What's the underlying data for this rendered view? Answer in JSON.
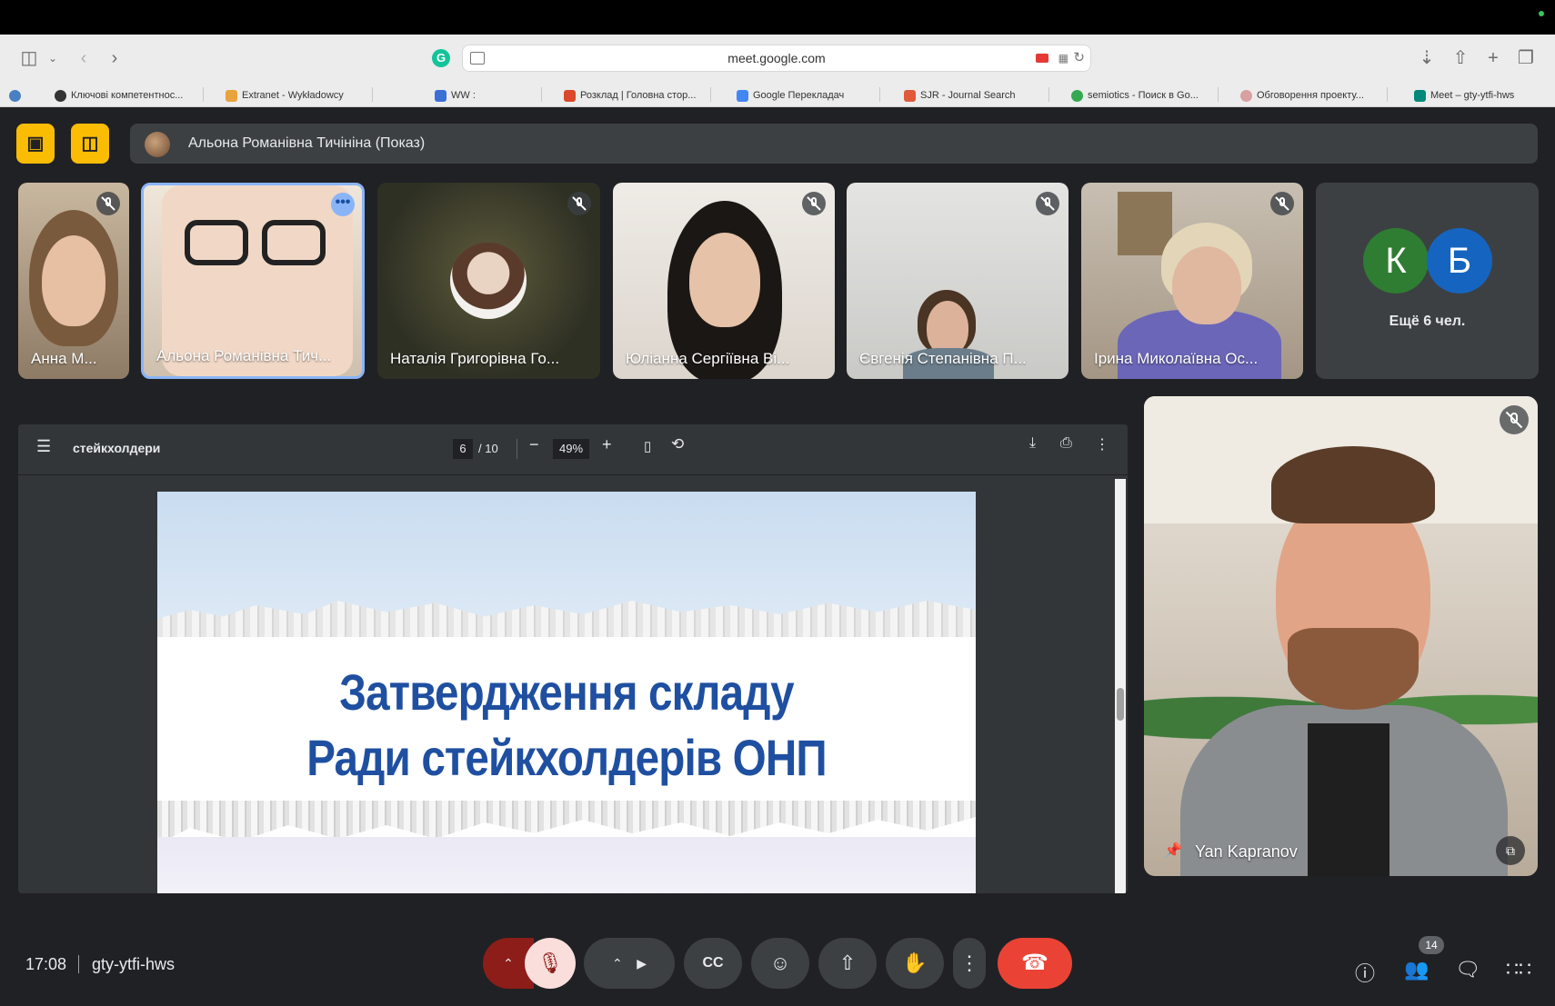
{
  "browser": {
    "url": "meet.google.com",
    "bookmarks": [
      {
        "label": "Ключові компетентнос...",
        "color": "#333333"
      },
      {
        "label": "Extranet - Wykładowcy",
        "color": "#e8a33d"
      },
      {
        "label": "WW :",
        "color": "#3b6fd6"
      },
      {
        "label": "Розклад | Головна стор...",
        "color": "#d9482b"
      },
      {
        "label": "Google Перекладач",
        "color": "#4285f4"
      },
      {
        "label": "SJR - Journal Search",
        "color": "#e0593a"
      },
      {
        "label": "semiotics - Поиск в Go...",
        "color": "#34a853"
      },
      {
        "label": "Обговорення проекту...",
        "color": "#d8a0a0"
      },
      {
        "label": "Meet – gty-ytfi-hws",
        "color": "#00897b"
      }
    ]
  },
  "presenter": {
    "label": "Альона Романівна Тичініна (Показ)"
  },
  "participants": [
    {
      "name": "Анна М..."
    },
    {
      "name": "Альона Романівна Тич..."
    },
    {
      "name": "Наталія Григорівна Го..."
    },
    {
      "name": "Юліанна Сергіївна Ві..."
    },
    {
      "name": "Євгенія Степанівна П..."
    },
    {
      "name": "Ірина Миколаївна Ос..."
    }
  ],
  "more_tile": {
    "avatars": [
      {
        "letter": "К",
        "color": "#2e7d32"
      },
      {
        "letter": "Б",
        "color": "#1565c0"
      }
    ],
    "label": "Ещё 6 чел."
  },
  "pdf": {
    "title": "стейкхолдери",
    "page": "6",
    "total": "/ 10",
    "zoom": "49%",
    "slide_line1": "Затвердження складу",
    "slide_line2": "Ради стейкхолдерів ОНП"
  },
  "speaker": {
    "name": "Yan Kapranov"
  },
  "footer": {
    "time": "17:08",
    "meeting_code": "gty-ytfi-hws",
    "people_count": "14"
  }
}
